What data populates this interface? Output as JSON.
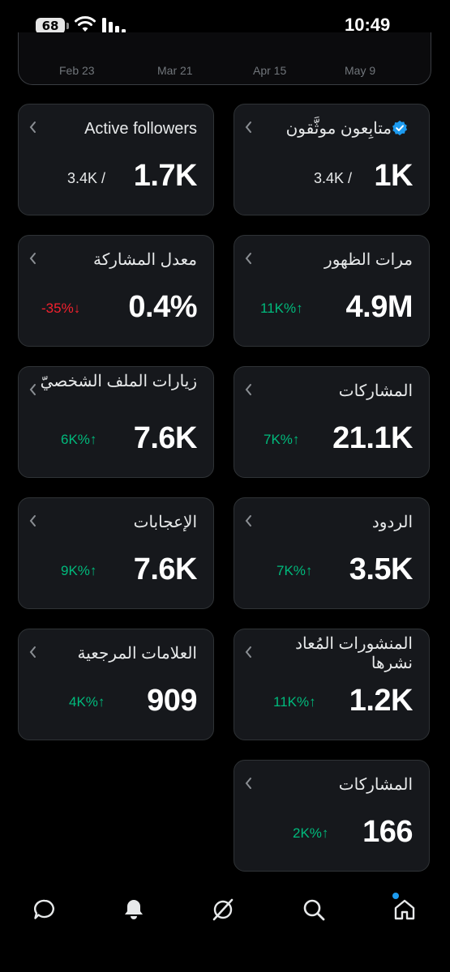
{
  "status_bar": {
    "battery": "68",
    "time": "10:49"
  },
  "chart": {
    "x_ticks": [
      "Feb 23",
      "Mar 21",
      "Apr 15",
      "May 9"
    ]
  },
  "cards": {
    "active_followers": {
      "title": "Active followers",
      "value": "1.7K",
      "total": "3.4K"
    },
    "verified_followers": {
      "title": "متابِعون موثَّقون",
      "value": "1K",
      "total": "3.4K"
    },
    "engagement_rate": {
      "title": "معدل المشاركة",
      "value": "0.4%",
      "delta": "-35%"
    },
    "impressions": {
      "title": "مرات الظهور",
      "value": "4.9M",
      "delta": "11K%"
    },
    "profile_visits": {
      "title": "زيارات الملف الشخصيّ",
      "value": "7.6K",
      "delta": "6K%"
    },
    "engagements": {
      "title": "المشاركات",
      "value": "21.1K",
      "delta": "7K%"
    },
    "likes": {
      "title": "الإعجابات",
      "value": "7.6K",
      "delta": "9K%"
    },
    "replies": {
      "title": "الردود",
      "value": "3.5K",
      "delta": "7K%"
    },
    "bookmarks": {
      "title": "العلامات المرجعية",
      "value": "909",
      "delta": "4K%"
    },
    "reposts": {
      "title": "المنشورات المُعاد نشرها",
      "value": "1.2K",
      "delta": "11K%"
    },
    "shares": {
      "title": "المشاركات",
      "value": "166",
      "delta": "2K%"
    }
  },
  "colors": {
    "up": "#00ba7c",
    "down": "#f4212e",
    "accent": "#1d9bf0"
  }
}
